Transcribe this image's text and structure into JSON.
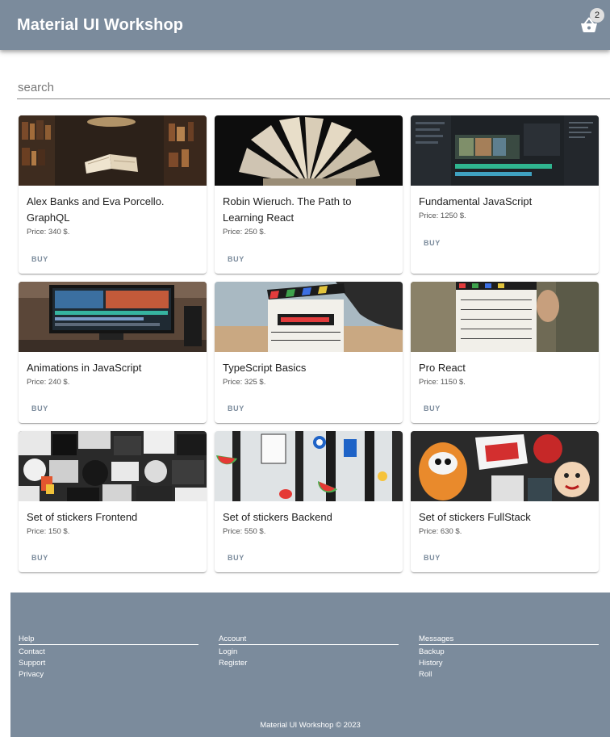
{
  "header": {
    "title": "Material UI Workshop",
    "cart_count": "2",
    "cart_icon": "shopping-basket-icon"
  },
  "search": {
    "placeholder": "search",
    "value": ""
  },
  "products": [
    {
      "title": "Alex Banks and Eva Porcello. GraphQL",
      "price": "Price: 340 $.",
      "buy": "BUY"
    },
    {
      "title": "Robin Wieruch. The Path to Learning React",
      "price": "Price: 250 $.",
      "buy": "BUY"
    },
    {
      "title": "Fundamental JavaScript",
      "price": "Price: 1250 $.",
      "buy": "BUY"
    },
    {
      "title": "Animations in JavaScript",
      "price": "Price: 240 $.",
      "buy": "BUY"
    },
    {
      "title": "TypeScript Basics",
      "price": "Price: 325 $.",
      "buy": "BUY"
    },
    {
      "title": "Pro React",
      "price": "Price: 1150 $.",
      "buy": "BUY"
    },
    {
      "title": "Set of stickers Frontend",
      "price": "Price: 150 $.",
      "buy": "BUY"
    },
    {
      "title": "Set of stickers Backend",
      "price": "Price: 550 $.",
      "buy": "BUY"
    },
    {
      "title": "Set of stickers FullStack",
      "price": "Price: 630 $.",
      "buy": "BUY"
    }
  ],
  "footer": {
    "columns": [
      {
        "heading": "Help",
        "links": [
          "Contact",
          "Support",
          "Privacy"
        ]
      },
      {
        "heading": "Account",
        "links": [
          "Login",
          "Register"
        ]
      },
      {
        "heading": "Messages",
        "links": [
          "Backup",
          "History",
          "Roll"
        ]
      }
    ],
    "copyright": "Material UI Workshop © 2023"
  },
  "colors": {
    "primary": "#7b8b9c",
    "text": "#212121"
  }
}
